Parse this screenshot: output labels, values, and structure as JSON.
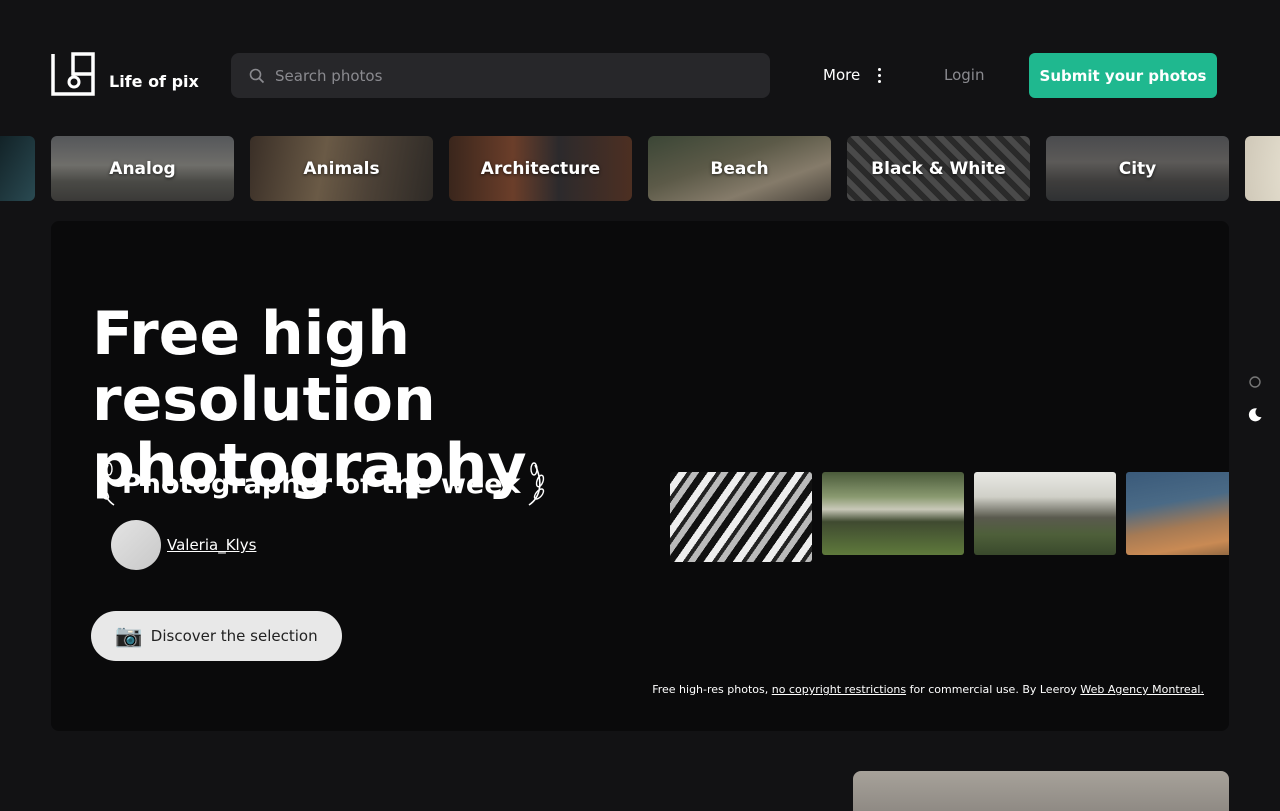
{
  "brand": {
    "name": "Life of pix"
  },
  "search": {
    "placeholder": "Search photos"
  },
  "nav": {
    "more_label": "More",
    "login_label": "Login",
    "submit_label": "Submit your photos"
  },
  "categories": [
    {
      "label": "Analog"
    },
    {
      "label": "Animals"
    },
    {
      "label": "Architecture"
    },
    {
      "label": "Beach"
    },
    {
      "label": "Black & White"
    },
    {
      "label": "City"
    }
  ],
  "hero": {
    "title": "Free high resolution photography",
    "photographer_heading": "Photographer of the week",
    "photographer_name": "Valeria_Klys",
    "discover_label": "Discover the selection",
    "discover_icon": "📷",
    "footnote": {
      "prefix": "Free high-res photos, ",
      "link1": "no copyright restrictions",
      "middle": " for commercial use. By Leeroy ",
      "link2": "Web Agency Montreal."
    }
  },
  "colors": {
    "accent": "#1fb88f",
    "background": "#121214",
    "hero_background": "#0a0a0b"
  },
  "icons": [
    "logo-icon",
    "search-icon",
    "more-dots-icon",
    "laurel-left-icon",
    "laurel-right-icon",
    "camera-icon",
    "sun-icon",
    "moon-icon"
  ]
}
